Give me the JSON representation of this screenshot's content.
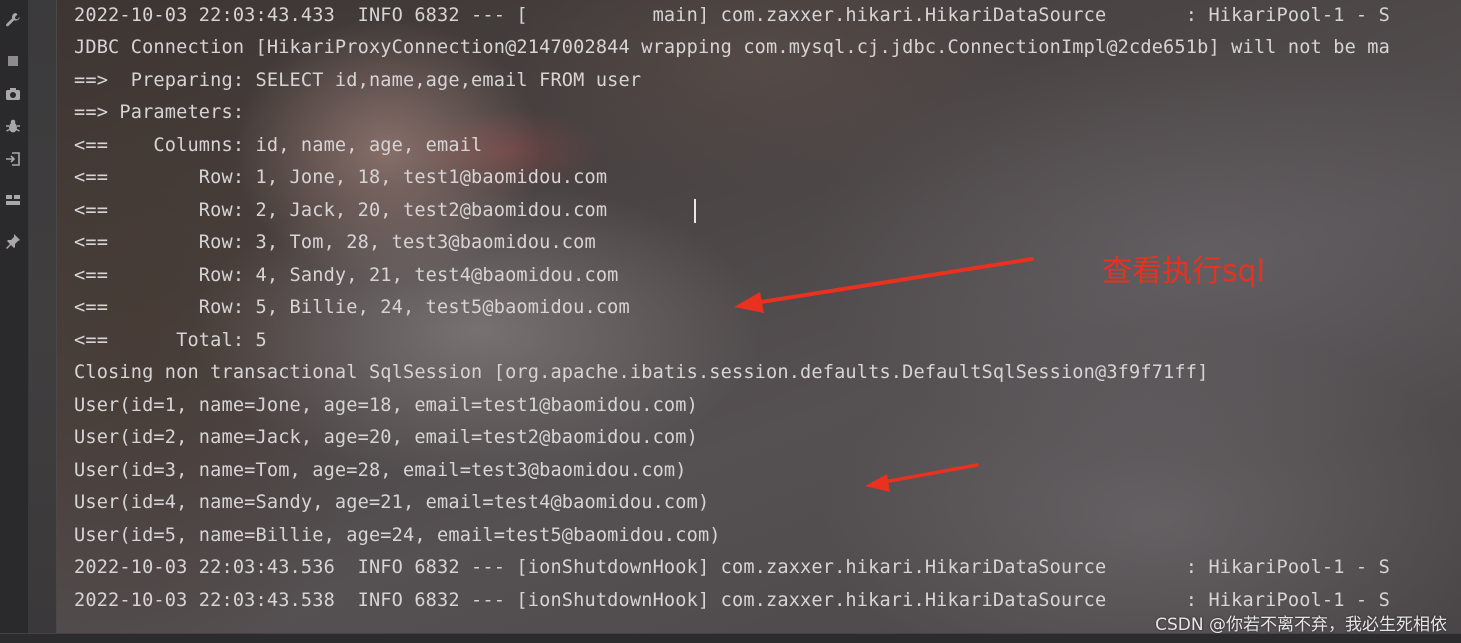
{
  "console": {
    "lines": [
      "2022-10-03 22:03:43.433  INFO 6832 --- [           main] com.zaxxer.hikari.HikariDataSource       : HikariPool-1 - S",
      "JDBC Connection [HikariProxyConnection@2147002844 wrapping com.mysql.cj.jdbc.ConnectionImpl@2cde651b] will not be ma",
      "==>  Preparing: SELECT id,name,age,email FROM user",
      "==> Parameters: ",
      "<==    Columns: id, name, age, email",
      "<==        Row: 1, Jone, 18, test1@baomidou.com",
      "<==        Row: 2, Jack, 20, test2@baomidou.com",
      "<==        Row: 3, Tom, 28, test3@baomidou.com",
      "<==        Row: 4, Sandy, 21, test4@baomidou.com",
      "<==        Row: 5, Billie, 24, test5@baomidou.com",
      "<==      Total: 5",
      "Closing non transactional SqlSession [org.apache.ibatis.session.defaults.DefaultSqlSession@3f9f71ff]",
      "User(id=1, name=Jone, age=18, email=test1@baomidou.com)",
      "User(id=2, name=Jack, age=20, email=test2@baomidou.com)",
      "User(id=3, name=Tom, age=28, email=test3@baomidou.com)",
      "User(id=4, name=Sandy, age=21, email=test4@baomidou.com)",
      "User(id=5, name=Billie, age=24, email=test5@baomidou.com)",
      "2022-10-03 22:03:43.536  INFO 6832 --- [ionShutdownHook] com.zaxxer.hikari.HikariDataSource       : HikariPool-1 - S",
      "2022-10-03 22:03:43.538  INFO 6832 --- [ionShutdownHook] com.zaxxer.hikari.HikariDataSource       : HikariPool-1 - S"
    ]
  },
  "annotation": {
    "label": "查看执行sql",
    "color": "#e8311f"
  },
  "toolbar": {
    "icons": [
      "wrench-icon",
      "stop-icon",
      "camera-icon",
      "bug-icon",
      "exit-icon",
      "layout-icon",
      "pin-icon"
    ]
  },
  "watermark": "CSDN @你若不离不弃，我必生死相依"
}
